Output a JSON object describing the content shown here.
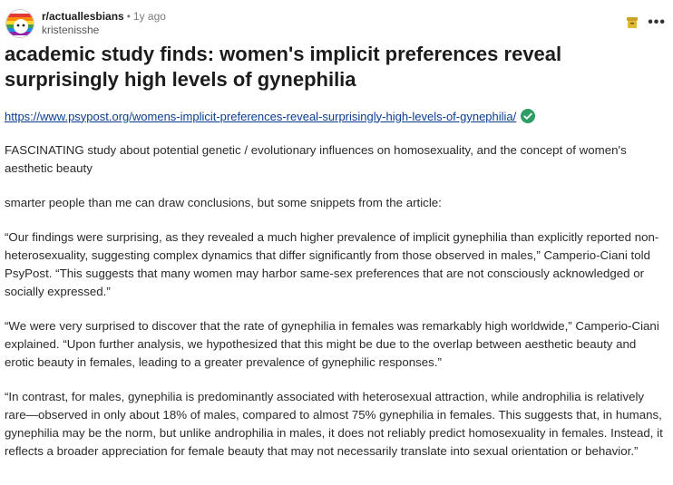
{
  "post": {
    "subreddit": "r/actuallesbians",
    "separator": "•",
    "age": "1y ago",
    "author": "kristenisshe",
    "title": "academic study finds: women's implicit preferences reveal surprisingly high levels of gynephilia",
    "link": "https://www.psypost.org/womens-implicit-preferences-reveal-surprisingly-high-levels-of-gynephilia/",
    "paragraphs": [
      "FASCINATING study about potential genetic / evolutionary influences on homosexuality, and the concept of women's aesthetic beauty",
      "smarter people than me can draw conclusions, but some snippets from the article:",
      "“Our findings were surprising, as they revealed a much higher prevalence of implicit gynephilia than explicitly reported non-heterosexuality, suggesting complex dynamics that differ significantly from those observed in males,” Camperio-Ciani told PsyPost. “This suggests that many women may harbor same-sex preferences that are not consciously acknowledged or socially expressed.”",
      "“We were very surprised to discover that the rate of gynephilia in females was remarkably high worldwide,” Camperio-Ciani explained. “Upon further analysis, we hypothesized that this might be due to the overlap between aesthetic beauty and erotic beauty in females, leading to a greater prevalence of gynephilic responses.”",
      "“In contrast, for males, gynephilia is predominantly associated with heterosexual attraction, while androphilia is relatively rare—observed in only about 18% of males, compared to almost 75% gynephilia in females. This suggests that, in humans, gynephilia may be the norm, but unlike androphilia in males, it does not reliably predict homosexuality in females. Instead, it reflects a broader appreciation for female beauty that may not necessarily translate into sexual orientation or behavior.”"
    ]
  },
  "icons": {
    "avatar": "rainbow-subreddit-avatar",
    "archive": "archive-box-icon",
    "more": "more-options-icon",
    "verified": "verified-check-icon"
  },
  "colors": {
    "link": "#0a3d91",
    "verified": "#2e9e66",
    "archive": "#c9a227"
  }
}
